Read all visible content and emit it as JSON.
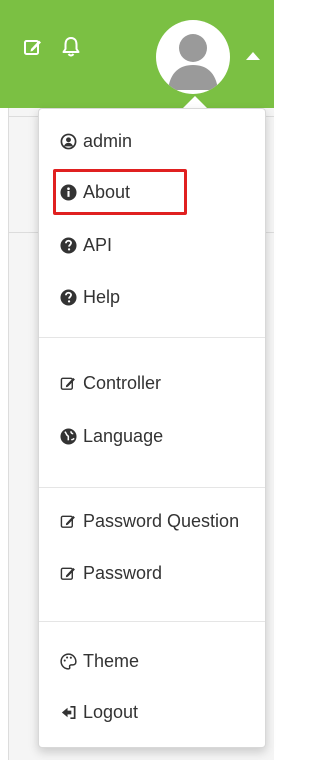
{
  "header": {
    "bg_color": "#7bc043",
    "icons": [
      "edit-icon",
      "bell-icon"
    ],
    "avatar_icon": "user-avatar-icon",
    "caret_icon": "caret-up-icon"
  },
  "menu": {
    "groups": [
      [
        {
          "label": "admin",
          "icon": "user-circle-icon"
        },
        {
          "label": "About",
          "icon": "info-circle-icon",
          "highlighted": true
        },
        {
          "label": "API",
          "icon": "question-circle-icon"
        },
        {
          "label": "Help",
          "icon": "question-circle-icon"
        }
      ],
      [
        {
          "label": "Controller",
          "icon": "edit-icon"
        },
        {
          "label": "Language",
          "icon": "globe-icon"
        }
      ],
      [
        {
          "label": "Password Question",
          "icon": "edit-icon"
        },
        {
          "label": "Password",
          "icon": "edit-icon"
        }
      ],
      [
        {
          "label": "Theme",
          "icon": "palette-icon"
        },
        {
          "label": "Logout",
          "icon": "sign-out-icon"
        }
      ]
    ],
    "highlight_color": "#e02020"
  }
}
